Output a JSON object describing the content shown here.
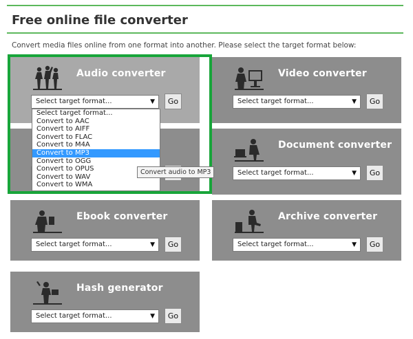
{
  "page": {
    "title": "Free online file converter",
    "intro": "Convert media files online from one format into another. Please select the target format below:"
  },
  "cards": {
    "audio": {
      "title": "Audio converter",
      "select": "Select target format...",
      "go": "Go",
      "icon": "audio-people-icon"
    },
    "video": {
      "title": "Video converter",
      "select": "Select target format...",
      "go": "Go",
      "icon": "video-person-icon"
    },
    "document": {
      "title": "Document converter",
      "select": "Select target format...",
      "go": "Go",
      "icon": "document-person-icon"
    },
    "ebook": {
      "title": "Ebook converter",
      "select": "Select target format...",
      "go": "Go",
      "icon": "ebook-reader-icon"
    },
    "archive": {
      "title": "Archive converter",
      "select": "Select target format...",
      "go": "Go",
      "icon": "archive-person-icon"
    },
    "hash": {
      "title": "Hash generator",
      "select": "Select target format...",
      "go": "Go",
      "icon": "hash-person-icon"
    }
  },
  "audio_dropdown": {
    "options": [
      "Select target format...",
      "Convert to AAC",
      "Convert to AIFF",
      "Convert to FLAC",
      "Convert to M4A",
      "Convert to MP3",
      "Convert to OGG",
      "Convert to OPUS",
      "Convert to WAV",
      "Convert to WMA"
    ],
    "selected_index": 5,
    "tooltip": "Convert audio to MP3"
  },
  "colors": {
    "accent": "#5cb85c",
    "highlight": "#18a53a",
    "card": "#8d8d8d",
    "card_active": "#a9a9a9",
    "option_selected": "#3399ff"
  }
}
